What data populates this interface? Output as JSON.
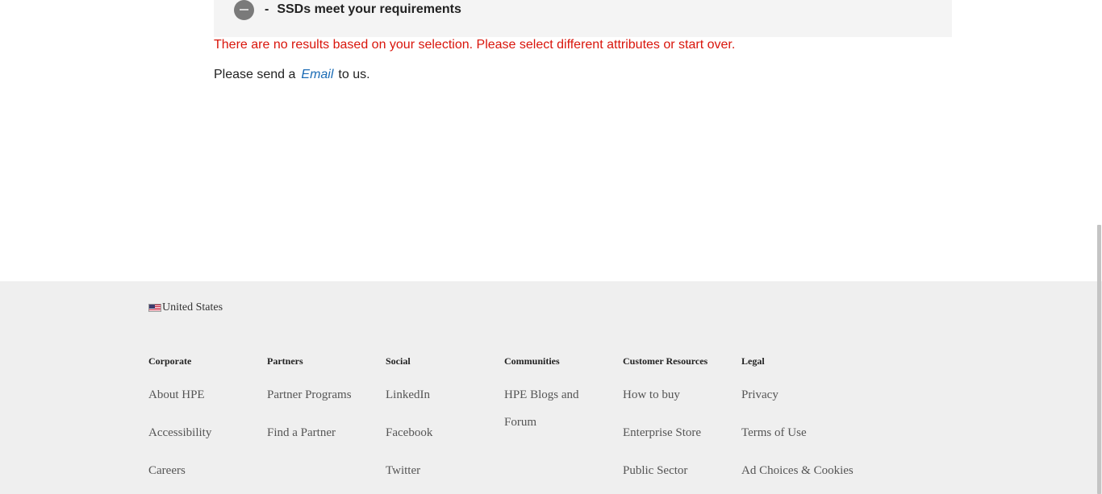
{
  "accordion": {
    "dash": "-",
    "title": "SSDs meet your requirements"
  },
  "message": {
    "no_results": "There are no results based on your selection. Please select different attributes or start over.",
    "send_prefix": "Please send a",
    "email_link": "Email",
    "send_suffix": "to us."
  },
  "footer": {
    "country": "United States",
    "columns": [
      {
        "heading": "Corporate",
        "links": [
          "About HPE",
          "Accessibility",
          "Careers"
        ]
      },
      {
        "heading": "Partners",
        "links": [
          "Partner Programs",
          "Find a Partner"
        ]
      },
      {
        "heading": "Social",
        "links": [
          "LinkedIn",
          "Facebook",
          "Twitter"
        ]
      },
      {
        "heading": "Communities",
        "links": [
          "HPE Blogs and Forum"
        ]
      },
      {
        "heading": "Customer Resources",
        "links": [
          "How to buy",
          "Enterprise Store",
          "Public Sector"
        ]
      },
      {
        "heading": "Legal",
        "links": [
          "Privacy",
          "Terms of Use",
          "Ad Choices & Cookies"
        ]
      }
    ]
  },
  "colors": {
    "error_text": "#d9150b",
    "link": "#1a6bb5",
    "footer_bg": "#efefef",
    "accordion_bg": "#f4f4f4"
  },
  "icons": {
    "collapse": "minus-circle-icon",
    "flag": "us-flag-icon"
  }
}
